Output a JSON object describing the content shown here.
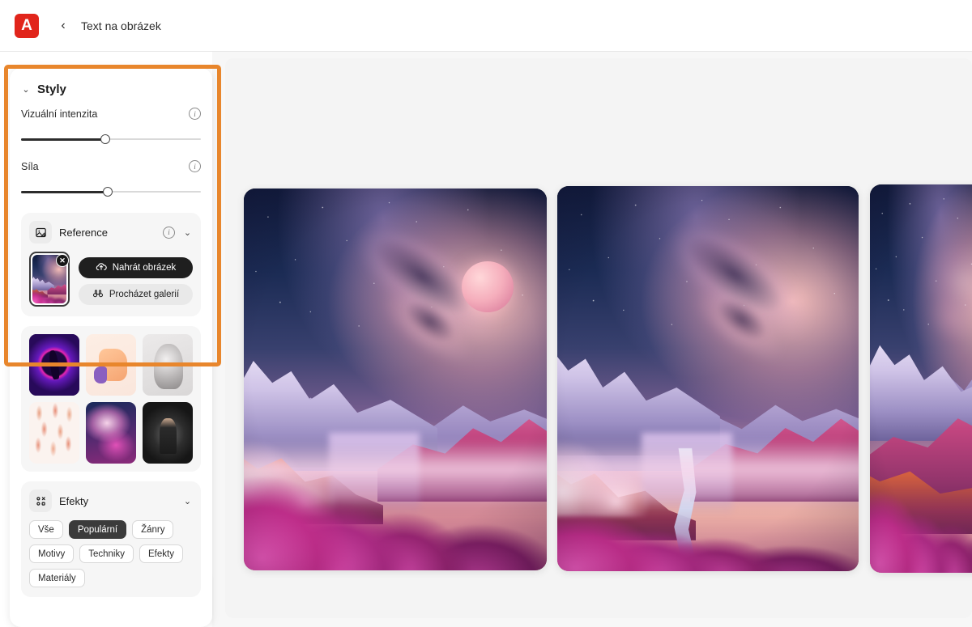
{
  "header": {
    "logo_glyph": "A",
    "logo_name": "adobe-logo",
    "back_glyph": "‹",
    "title": "Text na obrázek"
  },
  "styles_panel": {
    "section_title": "Styly",
    "collapse_glyph": "⌄",
    "sliders": [
      {
        "label": "Vizuální intenzita",
        "value": 47,
        "info": "i"
      },
      {
        "label": "Síla",
        "value": 48,
        "info": "i"
      }
    ],
    "reference": {
      "label": "Reference",
      "icon_name": "reference-image-icon",
      "info": "i",
      "chevron": "⌄",
      "remove_glyph": "✕",
      "upload_button": "Nahrát obrázek",
      "gallery_button": "Procházet galerií"
    },
    "style_tiles": [
      {
        "name": "neon-silhouette"
      },
      {
        "name": "thumbs-up-illustration"
      },
      {
        "name": "greyscale-bust-portrait"
      },
      {
        "name": "figure-pattern"
      },
      {
        "name": "pink-cloud-landscape"
      },
      {
        "name": "dark-seated-portrait"
      }
    ],
    "effects": {
      "label": "Efekty",
      "icon_name": "effects-grid-icon",
      "chevron": "⌄",
      "chips": [
        {
          "label": "Vše",
          "active": false
        },
        {
          "label": "Populární",
          "active": true
        },
        {
          "label": "Žánry",
          "active": false
        },
        {
          "label": "Motivy",
          "active": false
        },
        {
          "label": "Techniky",
          "active": false
        },
        {
          "label": "Efekty",
          "active": false
        },
        {
          "label": "Materiály",
          "active": false
        }
      ]
    }
  },
  "results": [
    {
      "name": "generated-image-1",
      "alt": "Fantasy krajina s hvězdnou oblohou, růžovou planetou, zasněženými horami a růžovými mraky"
    },
    {
      "name": "generated-image-2",
      "alt": "Fantasy krajina s řekou v údolí, hvězdnou oblohou a purpurovými horami"
    },
    {
      "name": "generated-image-3",
      "alt": "Fantasy krajina s horou a růžovými květinovými mraky"
    }
  ],
  "highlight": {
    "name": "highlight-box",
    "color": "#e8862c"
  }
}
